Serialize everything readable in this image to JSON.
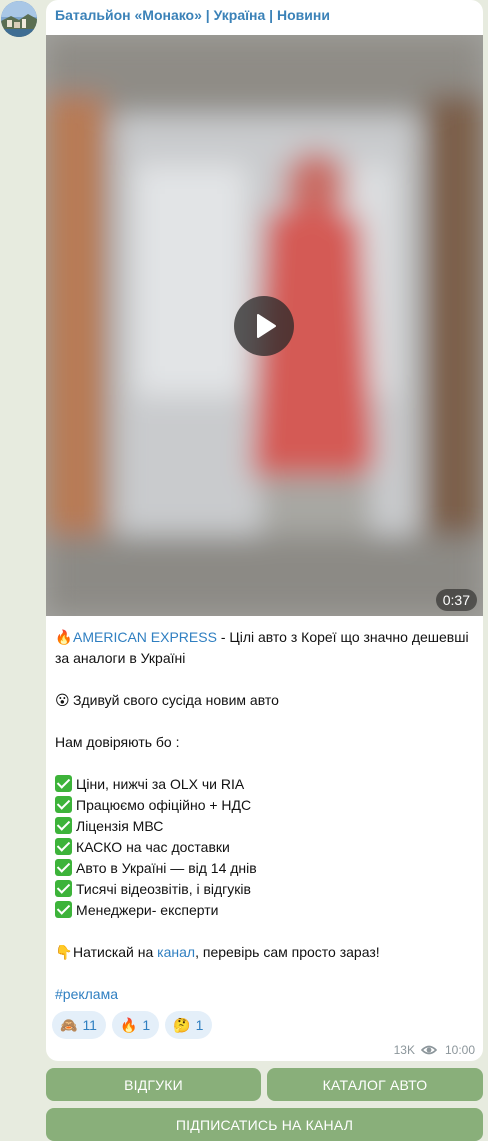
{
  "channel": {
    "title": "Батальйон «Монако» | Україна | Новини",
    "avatar_icon": "channel-avatar"
  },
  "video": {
    "duration": "0:37",
    "play_icon": "play-icon"
  },
  "post": {
    "line1_emoji": "🔥",
    "line1_link": "AMERICAN EXPRESS",
    "line1_text": " - Цілі авто з Кореї що значно дешевші за аналоги в Україні",
    "line2_emoji": "😮",
    "line2_text": "Здивуй свого сусіда новим авто",
    "trust_heading": "Нам довіряють бо :",
    "benefits": [
      "Ціни, нижчі за OLX чи RIA",
      "Працюємо офіційно + НДС",
      "Ліцензія МВС",
      "КАСКО на час доставки",
      "Авто в Україні — від 14 днів",
      "Тисячі відеозвітів, і відгуків",
      "Менеджери- експерти"
    ],
    "cta_emoji": "👇",
    "cta_before": "Натискай на ",
    "cta_link": "канал",
    "cta_after": ", перевірь сам просто зараз!",
    "hashtag": "#реклама"
  },
  "reactions": [
    {
      "emoji": "🙈",
      "count": "11"
    },
    {
      "emoji": "🔥",
      "count": "1"
    },
    {
      "emoji": "🤔",
      "count": "1"
    }
  ],
  "meta": {
    "views": "13K",
    "time": "10:00",
    "views_icon": "eye-icon"
  },
  "buttons": {
    "reviews": "ВІДГУКИ",
    "catalog": "КАТАЛОГ АВТО",
    "subscribe": "ПІДПИСАТИСЬ НА КАНАЛ"
  },
  "colors": {
    "link": "#2f7fc1",
    "button_bg": "#78a569",
    "chat_bg": "#e7ebdf",
    "check": "#3db33a"
  }
}
